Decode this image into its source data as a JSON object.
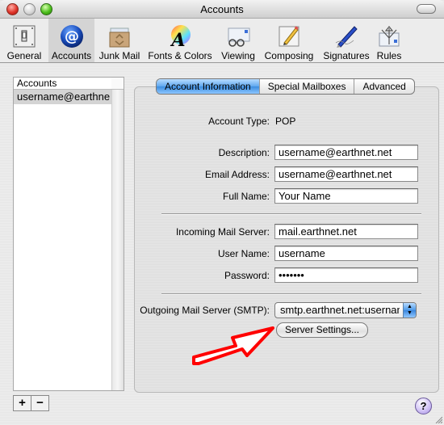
{
  "window": {
    "title": "Accounts"
  },
  "toolbar": {
    "items": [
      {
        "label": "General",
        "icon": "light-switch-icon",
        "selected": false
      },
      {
        "label": "Accounts",
        "icon": "at-sign-icon",
        "selected": true
      },
      {
        "label": "Junk Mail",
        "icon": "recycle-box-icon",
        "selected": false
      },
      {
        "label": "Fonts & Colors",
        "icon": "font-color-wheel-icon",
        "selected": false
      },
      {
        "label": "Viewing",
        "icon": "glasses-envelope-icon",
        "selected": false
      },
      {
        "label": "Composing",
        "icon": "pencil-paper-icon",
        "selected": false
      },
      {
        "label": "Signatures",
        "icon": "pen-icon",
        "selected": false
      },
      {
        "label": "Rules",
        "icon": "rules-arrows-icon",
        "selected": false
      }
    ]
  },
  "accounts_list": {
    "header": "Accounts",
    "items": [
      "username@earthne"
    ]
  },
  "list_controls": {
    "add": "+",
    "remove": "−"
  },
  "tabs": [
    {
      "label": "Account Information",
      "active": true
    },
    {
      "label": "Special Mailboxes",
      "active": false
    },
    {
      "label": "Advanced",
      "active": false
    }
  ],
  "form": {
    "account_type_label": "Account Type:",
    "account_type_value": "POP",
    "description_label": "Description:",
    "description_value": "username@earthnet.net",
    "email_label": "Email Address:",
    "email_value": "username@earthnet.net",
    "fullname_label": "Full Name:",
    "fullname_value": "Your Name",
    "incoming_label": "Incoming Mail Server:",
    "incoming_value": "mail.earthnet.net",
    "username_label": "User Name:",
    "username_value": "username",
    "password_label": "Password:",
    "password_value": "•••••••",
    "smtp_label": "Outgoing Mail Server (SMTP):",
    "smtp_value": "smtp.earthnet.net:username",
    "server_settings_button": "Server Settings..."
  },
  "help": {
    "label": "?"
  },
  "annotation": {
    "color": "#ff0000"
  }
}
